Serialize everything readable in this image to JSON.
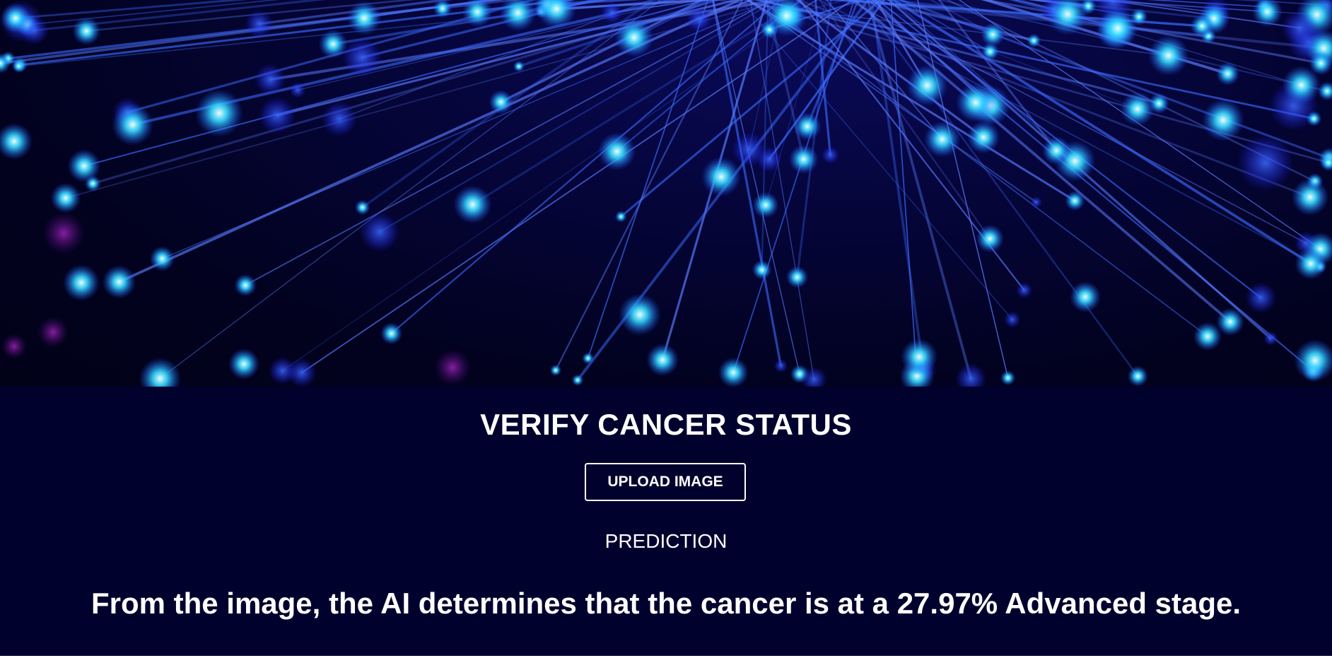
{
  "hero": {
    "image_name": "fiber-optic-burst-image"
  },
  "panel": {
    "title": "VERIFY CANCER STATUS",
    "upload_button_label": "UPLOAD IMAGE",
    "prediction_label": "PREDICTION",
    "result_text": "From the image, the AI determines that the cancer is at a 27.97% Advanced stage."
  },
  "colors": {
    "panel_background": "#01012e",
    "text": "#ffffff",
    "fiber_glow": "#2f7bff",
    "fiber_tip": "#7ef3ff"
  }
}
